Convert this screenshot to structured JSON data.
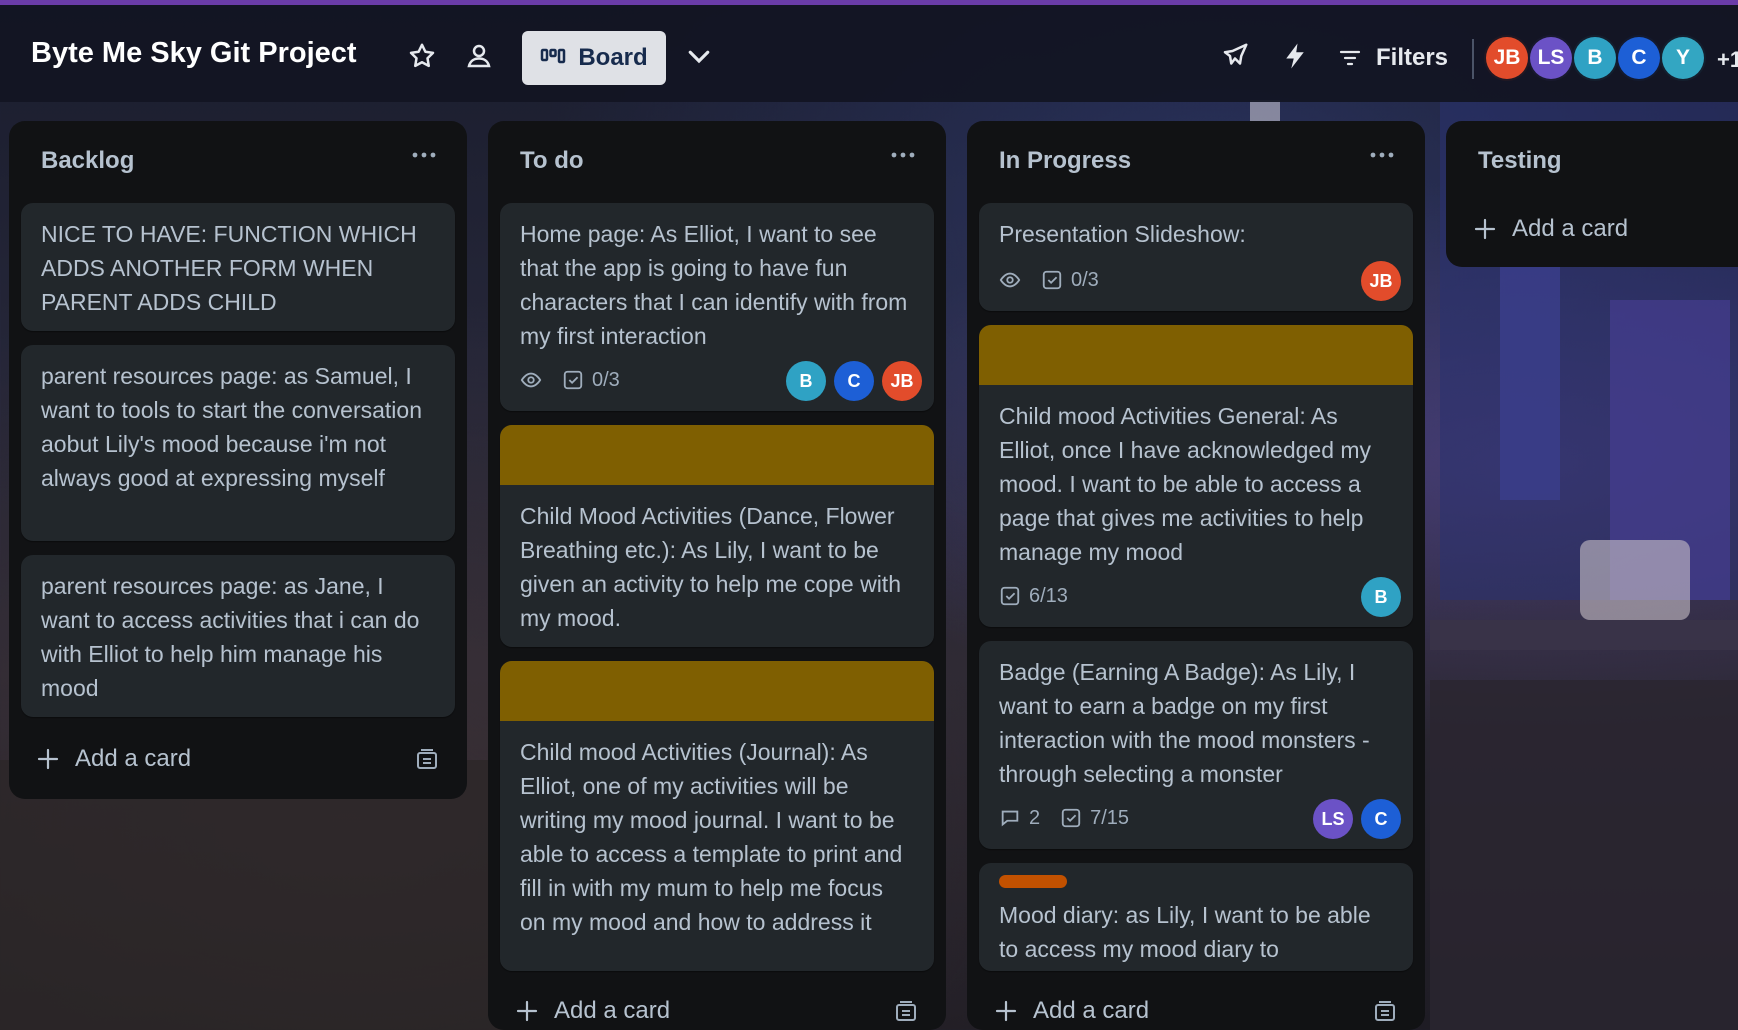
{
  "header": {
    "board_title": "Byte Me Sky Git Project",
    "view_label": "Board",
    "filters_label": "Filters",
    "members": [
      "JB",
      "LS",
      "B",
      "C",
      "Y"
    ],
    "more_members": "+1"
  },
  "colors": {
    "cover_mustard": "#7f5f01",
    "label_orange": "#c25100",
    "avatar_jb": "#e24c2b",
    "avatar_ls": "#6b52c6",
    "avatar_b": "#2fa2c4",
    "avatar_c": "#1d5fd6",
    "avatar_y": "#33a6c2"
  },
  "lists": [
    {
      "title": "Backlog",
      "add_card": "Add a card",
      "cards": [
        {
          "text": "NICE TO HAVE: FUNCTION WHICH ADDS ANOTHER FORM WHEN PARENT ADDS CHILD"
        },
        {
          "text": "parent resources page:  as Samuel, I want to tools to start the conversation aobut Lily's mood because i'm not always good at expressing myself"
        },
        {
          "text": "parent resources page:  as Jane, I want to access activities that i can do with Elliot to help him manage his mood"
        }
      ]
    },
    {
      "title": "To do",
      "add_card": "Add a card",
      "cards": [
        {
          "text": "Home page: As Elliot, I want to see that the app is going to have fun characters that I can identify with from my first interaction",
          "checklist": "0/3",
          "members": [
            "B",
            "C",
            "JB"
          ]
        },
        {
          "text": "Child Mood Activities (Dance, Flower Breathing etc.): As Lily, I want to be given an activity to help me cope with my mood."
        },
        {
          "text": "Child mood Activities (Journal): As Elliot, one of my activities will be writing my mood journal. I want to be able to access a template to print and fill in with my mum to help me focus on my mood and how to address it"
        }
      ]
    },
    {
      "title": "In Progress",
      "add_card": "Add a card",
      "cards": [
        {
          "text": "Presentation Slideshow:",
          "checklist": "0/3",
          "members": [
            "JB"
          ]
        },
        {
          "text": "Child mood Activities General: As Elliot, once I have acknowledged my mood. I want to be able to access a page that gives me activities to help manage my mood",
          "checklist": "6/13",
          "members": [
            "B"
          ]
        },
        {
          "text": "Badge (Earning A Badge): As Lily, I want to earn a badge on my first interaction with the mood monsters - through selecting a monster",
          "comments": "2",
          "checklist": "7/15",
          "members": [
            "LS",
            "C"
          ]
        },
        {
          "text": "Mood diary: as Lily, I want to be able to access my mood diary to"
        }
      ]
    },
    {
      "title": "Testing",
      "add_card": "Add a card"
    }
  ]
}
